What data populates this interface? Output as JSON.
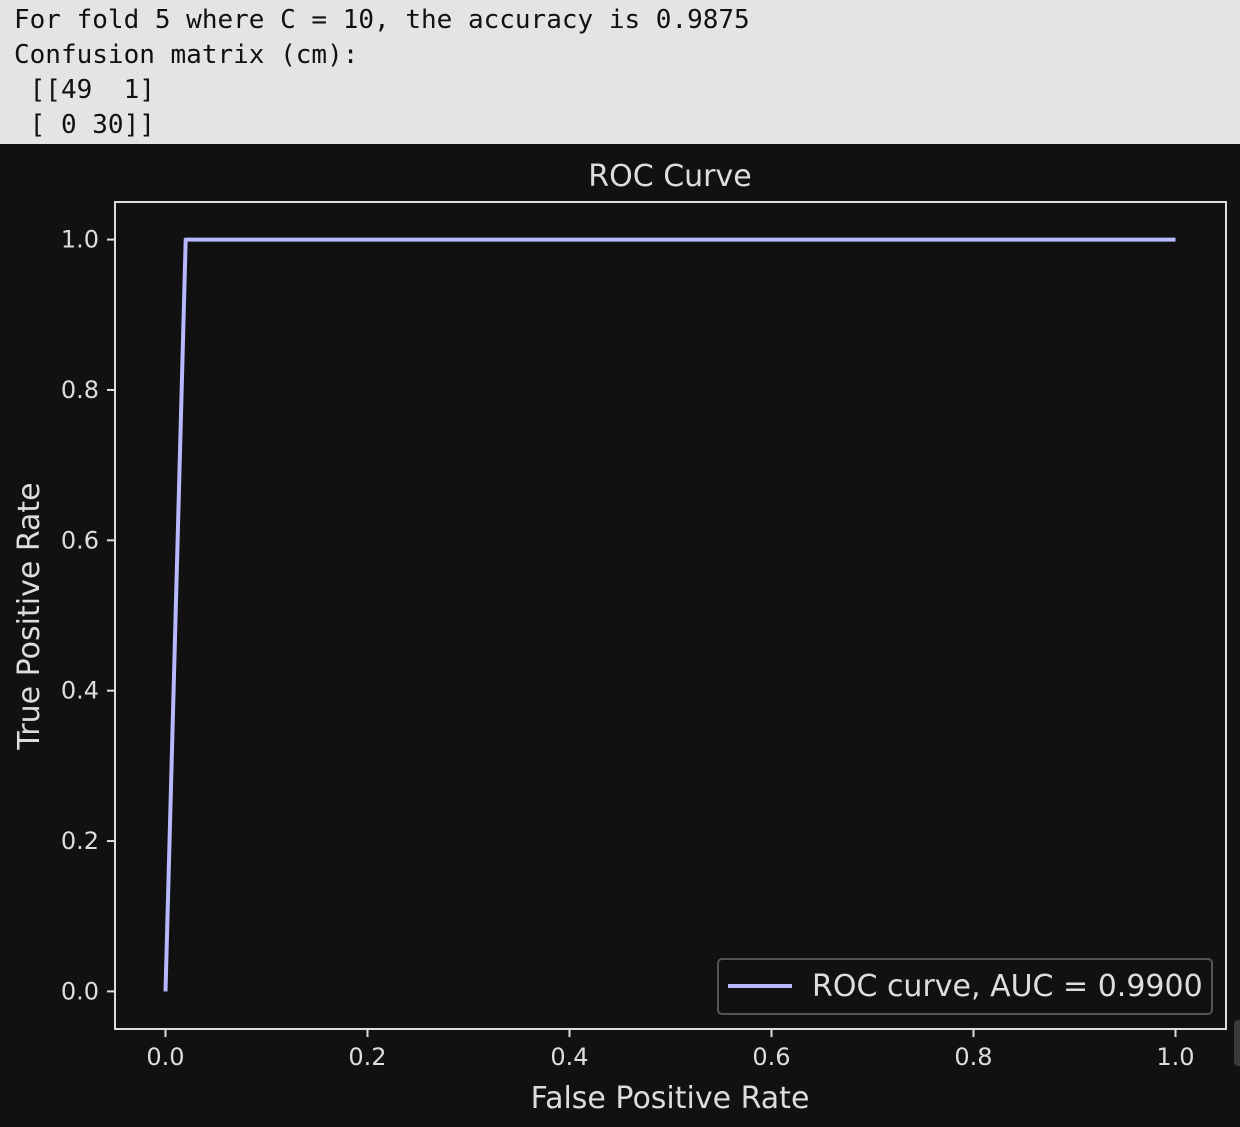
{
  "console": {
    "lines": [
      "For fold 5 where C = 10, the accuracy is 0.9875",
      "Confusion matrix (cm):",
      " [[49  1]",
      " [ 0 30]]"
    ]
  },
  "chart_data": {
    "type": "line",
    "title": "ROC Curve",
    "xlabel": "False Positive Rate",
    "ylabel": "True Positive Rate",
    "xlim": [
      -0.05,
      1.05
    ],
    "ylim": [
      -0.05,
      1.05
    ],
    "x_ticks": [
      0.0,
      0.2,
      0.4,
      0.6,
      0.8,
      1.0
    ],
    "y_ticks": [
      0.0,
      0.2,
      0.4,
      0.6,
      0.8,
      1.0
    ],
    "x_tick_labels": [
      "0.0",
      "0.2",
      "0.4",
      "0.6",
      "0.8",
      "1.0"
    ],
    "y_tick_labels": [
      "0.0",
      "0.2",
      "0.4",
      "0.6",
      "0.8",
      "1.0"
    ],
    "grid": false,
    "legend_position": "lower-right",
    "series": [
      {
        "name": "ROC curve, AUC = 0.9900",
        "color": "#b8b8ff",
        "x": [
          0.0,
          0.02,
          1.0
        ],
        "y": [
          0.0,
          1.0,
          1.0
        ]
      }
    ],
    "colors": {
      "background": "#111111",
      "axes": "#dddddd",
      "text": "#dddddd",
      "legend_bg": "#111111",
      "legend_border": "#555555"
    }
  }
}
